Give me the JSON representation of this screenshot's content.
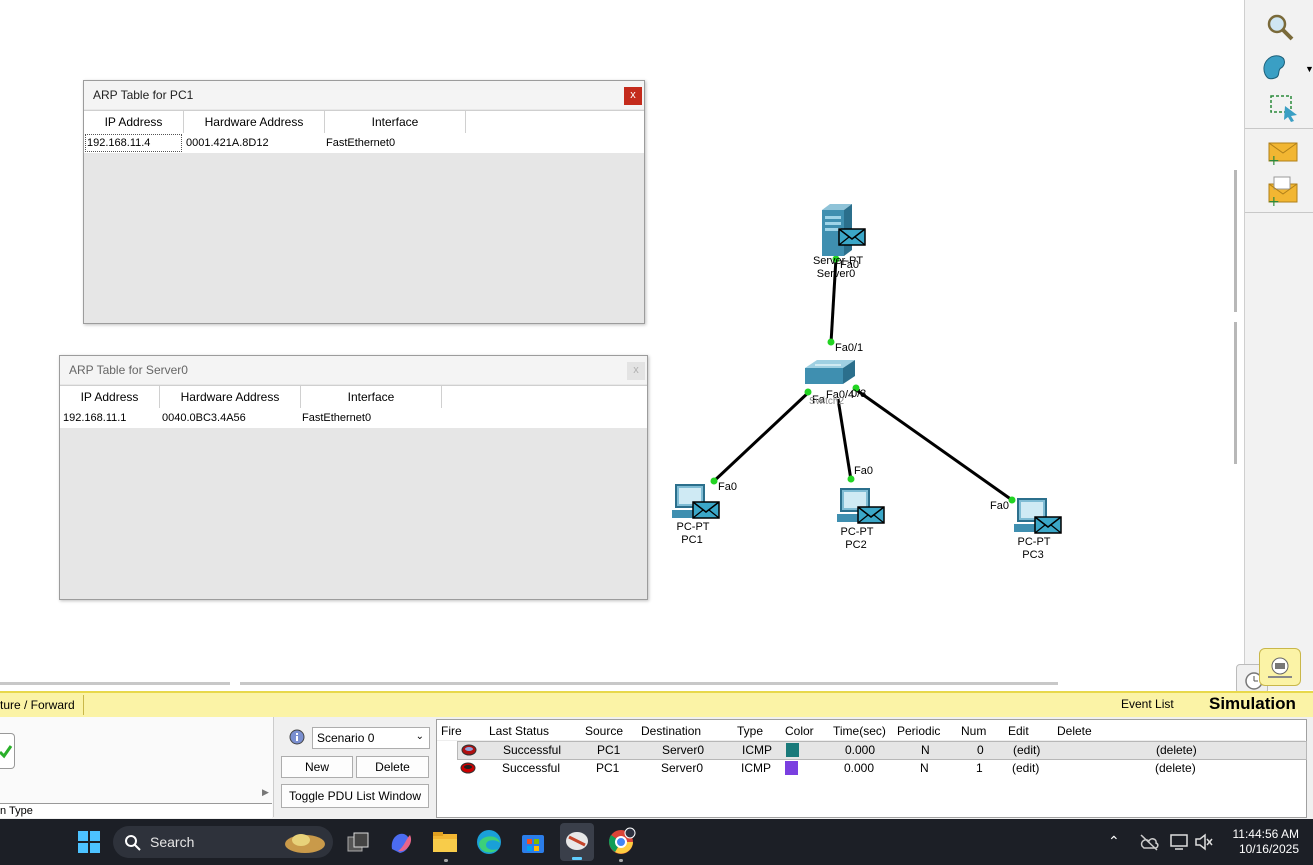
{
  "arp_pc1": {
    "title": "ARP Table for PC1",
    "close": "x",
    "columns": [
      "IP Address",
      "Hardware Address",
      "Interface"
    ],
    "rows": [
      [
        "192.168.11.4",
        "0001.421A.8D12",
        "FastEthernet0"
      ]
    ]
  },
  "arp_server0": {
    "title": "ARP Table for Server0",
    "close": "x",
    "columns": [
      "IP Address",
      "Hardware Address",
      "Interface"
    ],
    "rows": [
      [
        "192.168.11.1",
        "0040.0BC3.4A56",
        "FastEthernet0"
      ]
    ]
  },
  "topology": {
    "server": {
      "type": "Server-PT",
      "name": "Server0",
      "port": "Fa0"
    },
    "switch": {
      "name": "Switch2",
      "ports": [
        "Fa0/1",
        "Fa0/4",
        "Fa0/3"
      ],
      "name_fragments": [
        "Fa",
        "0/3",
        "/"
      ]
    },
    "pc1": {
      "type": "PC-PT",
      "name": "PC1",
      "port": "Fa0"
    },
    "pc2": {
      "type": "PC-PT",
      "name": "PC2",
      "port": "Fa0"
    },
    "pc3": {
      "type": "PC-PT",
      "name": "PC3",
      "port": "Fa0"
    }
  },
  "sim_bar": {
    "mode_tab": "ture / Forward",
    "event_list": "Event List",
    "simulation": "Simulation"
  },
  "scenario": {
    "selected": "Scenario 0",
    "new": "New",
    "delete": "Delete",
    "toggle": "Toggle PDU List Window",
    "left_label": "n Type"
  },
  "pdu_list": {
    "columns": [
      "Fire",
      "Last Status",
      "Source",
      "Destination",
      "Type",
      "Color",
      "Time(sec)",
      "Periodic",
      "Num",
      "Edit",
      "Delete"
    ],
    "rows": [
      {
        "status": "Successful",
        "source": "PC1",
        "destination": "Server0",
        "type": "ICMP",
        "color": "#1a7a7a",
        "time": "0.000",
        "periodic": "N",
        "num": "0",
        "edit": "(edit)",
        "delete": "(delete)"
      },
      {
        "status": "Successful",
        "source": "PC1",
        "destination": "Server0",
        "type": "ICMP",
        "color": "#7a3fe0",
        "time": "0.000",
        "periodic": "N",
        "num": "1",
        "edit": "(edit)",
        "delete": "(delete)"
      }
    ]
  },
  "taskbar": {
    "search": "Search",
    "time": "11:44:56 AM",
    "date": "10/16/2025"
  },
  "icons": [
    "windows-start-icon",
    "search-icon",
    "task-view-icon",
    "copilot-icon",
    "file-explorer-icon",
    "edge-icon",
    "store-icon",
    "packet-tracer-icon",
    "chrome-icon",
    "chevron-up-icon",
    "onedrive-icon",
    "network-icon",
    "volume-muted-icon",
    "zoom-icon",
    "palette-icon",
    "resize-select-icon",
    "add-simple-pdu-icon",
    "add-complex-pdu-icon",
    "realtime-clock-icon",
    "simulation-mode-icon"
  ]
}
